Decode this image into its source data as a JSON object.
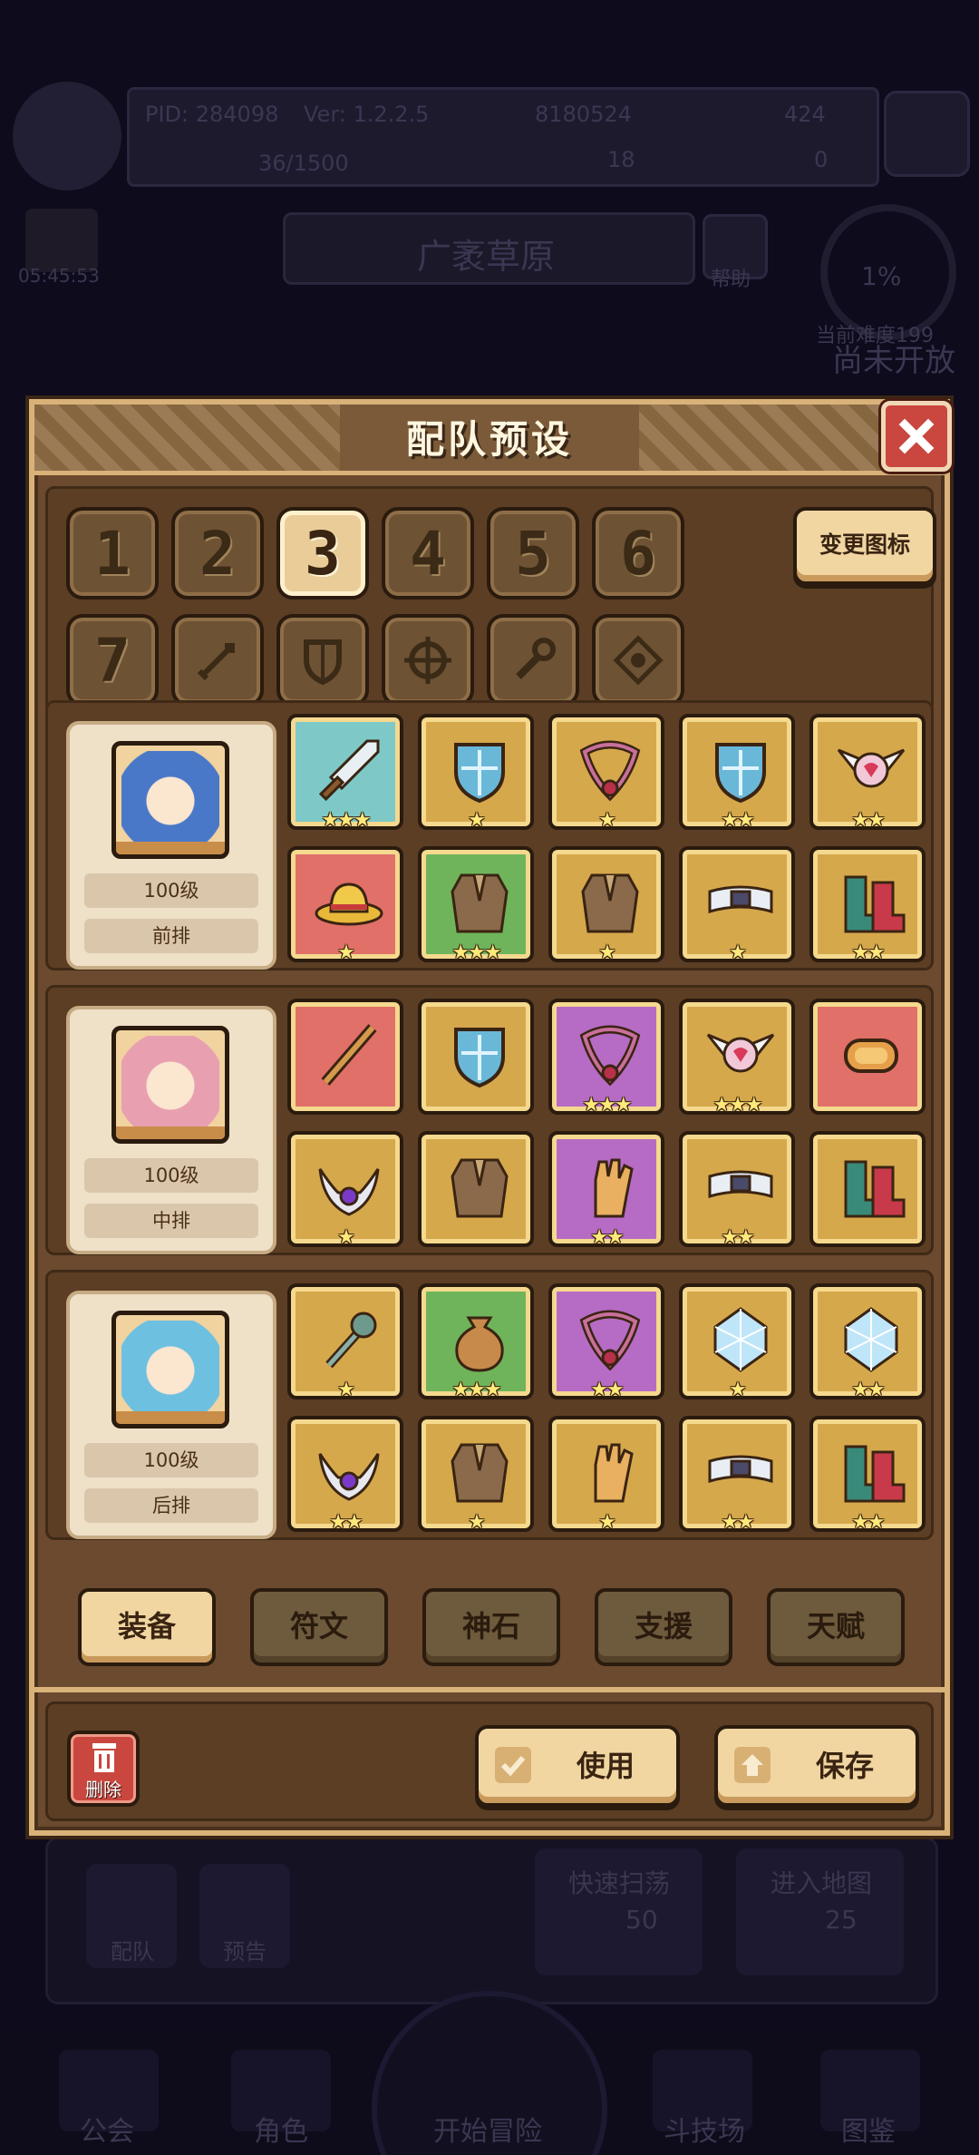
{
  "background": {
    "pid": "PID: 284098",
    "version": "Ver: 1.2.2.5",
    "gold": "8180524",
    "gems": "424",
    "stamina": "36/1500",
    "currency_a": "18",
    "currency_b": "0",
    "timer": "05:45:53",
    "stage_name": "广袤草原",
    "help_label": "帮助",
    "progress_percent": "1%",
    "difficulty_text": "当前难度199",
    "unopened_text": "尚未开放",
    "team_label": "配队",
    "preview_label": "预告",
    "quick_sweep_label": "快速扫荡",
    "quick_sweep_cost": "50",
    "enter_map_label": "进入地图",
    "enter_map_cost": "25",
    "nav": [
      "公会",
      "角色",
      "开始冒险",
      "斗技场",
      "图鉴"
    ]
  },
  "modal": {
    "title": "配队预设",
    "change_icon_label": "变更图标",
    "slots": [
      "1",
      "2",
      "3",
      "4",
      "5",
      "6",
      "7",
      "sword-icon",
      "shield-icon",
      "crosshair-icon",
      "wrench-icon",
      "target-icon"
    ],
    "active_slot_index": 2,
    "characters": [
      {
        "level": "100级",
        "position": "前排",
        "portrait_color": "#4a78c8",
        "equipment": [
          {
            "icon": "sword-icon",
            "rarity": "teal",
            "stars": 3
          },
          {
            "icon": "crystal-shield-icon",
            "rarity": "gold",
            "stars": 1
          },
          {
            "icon": "heart-necklace-icon",
            "rarity": "gold",
            "stars": 1
          },
          {
            "icon": "feather-shield-icon",
            "rarity": "gold",
            "stars": 2
          },
          {
            "icon": "winged-heart-icon",
            "rarity": "gold",
            "stars": 2
          },
          {
            "icon": "straw-hat-icon",
            "rarity": "red",
            "stars": 1
          },
          {
            "icon": "cloak-icon",
            "rarity": "green",
            "stars": 3
          },
          {
            "icon": "demon-armor-icon",
            "rarity": "gold",
            "stars": 1
          },
          {
            "icon": "white-belt-icon",
            "rarity": "gold",
            "stars": 1
          },
          {
            "icon": "boots-icon",
            "rarity": "gold",
            "stars": 2
          }
        ]
      },
      {
        "level": "100级",
        "position": "中排",
        "portrait_color": "#e8a0b0",
        "equipment": [
          {
            "icon": "staff-icon",
            "rarity": "red",
            "stars": 0
          },
          {
            "icon": "wooden-shield-icon",
            "rarity": "gold",
            "stars": 0
          },
          {
            "icon": "heart-necklace-icon",
            "rarity": "purple",
            "stars": 3
          },
          {
            "icon": "heart-orb-icon",
            "rarity": "gold",
            "stars": 3
          },
          {
            "icon": "ring-icon",
            "rarity": "red",
            "stars": 0
          },
          {
            "icon": "crown-icon",
            "rarity": "gold",
            "stars": 1
          },
          {
            "icon": "armor-icon",
            "rarity": "gold",
            "stars": 0
          },
          {
            "icon": "glove-icon",
            "rarity": "purple",
            "stars": 2
          },
          {
            "icon": "belt-icon",
            "rarity": "gold",
            "stars": 2
          },
          {
            "icon": "white-boots-icon",
            "rarity": "gold",
            "stars": 0
          }
        ]
      },
      {
        "level": "100级",
        "position": "后排",
        "portrait_color": "#6ec0e0",
        "equipment": [
          {
            "icon": "mace-icon",
            "rarity": "gold",
            "stars": 1
          },
          {
            "icon": "pouch-icon",
            "rarity": "green",
            "stars": 3
          },
          {
            "icon": "heart-necklace-icon",
            "rarity": "purple",
            "stars": 2
          },
          {
            "icon": "ice-crystal-icon",
            "rarity": "gold",
            "stars": 1
          },
          {
            "icon": "crystal-ring-icon",
            "rarity": "gold",
            "stars": 2
          },
          {
            "icon": "horned-helm-icon",
            "rarity": "gold",
            "stars": 2
          },
          {
            "icon": "ice-armor-icon",
            "rarity": "gold",
            "stars": 1
          },
          {
            "icon": "ice-glove-icon",
            "rarity": "gold",
            "stars": 1
          },
          {
            "icon": "dark-belt-icon",
            "rarity": "gold",
            "stars": 2
          },
          {
            "icon": "dark-boots-icon",
            "rarity": "gold",
            "stars": 2
          }
        ]
      }
    ],
    "tabs": [
      "装备",
      "符文",
      "神石",
      "支援",
      "天赋"
    ],
    "active_tab_index": 0,
    "delete_label": "删除",
    "use_label": "使用",
    "save_label": "保存"
  }
}
